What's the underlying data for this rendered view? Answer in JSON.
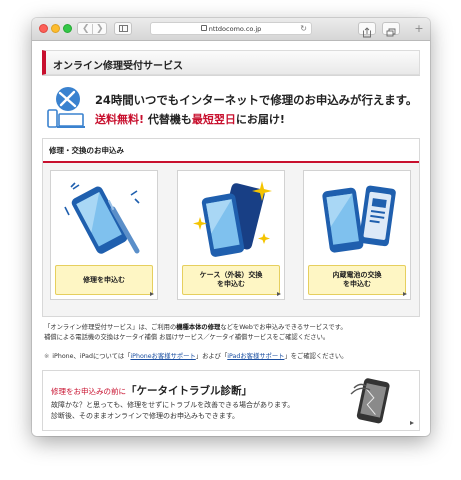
{
  "browser": {
    "url": "nttdocomo.co.jp",
    "icons": [
      "back-icon",
      "forward-icon",
      "sidebar-icon",
      "lock-icon",
      "reload-icon",
      "share-icon",
      "tabs-icon",
      "new-tab-icon"
    ]
  },
  "header": {
    "title": "オンライン修理受付サービス"
  },
  "promo": {
    "line1": "24時間いつでもインターネットで修理のお申込みが行えます。",
    "free": "送料無料",
    "excl": "!",
    "mid": " 代替機も",
    "fastest": "最短翌日",
    "tail": "にお届け!"
  },
  "panel": {
    "heading": "修理・交換のお申込み",
    "cards": [
      {
        "label": "修理を申込む"
      },
      {
        "label": "ケース（外装）交換\nを申込む"
      },
      {
        "label": "内蔵電池の交換\nを申込む"
      }
    ]
  },
  "notes": {
    "n1a": "「オンライン修理受付サービス」は、ご利用の",
    "n1b": "機種本体の修理",
    "n1c": "などをWebでお申込みできるサービスです。",
    "n1d": "補償による電話機の交換はケータイ補償 お届けサービス／ケータイ補償サービスをご確認ください。",
    "mark": "※",
    "n2a": "iPhone、iPadについては「",
    "link1": "iPhoneお客様サポート",
    "n2b": "」および「",
    "link2": "iPadお客様サポート",
    "n2c": "」をご確認ください。"
  },
  "trouble": {
    "pre": "修理をお申込みの前に",
    "main": "「ケータイトラブル診断」",
    "desc1": "故障かな？と思っても、修理をせずにトラブルを改善できる場合があります。",
    "desc2": "診断後、そのままオンラインで修理のお申込みもできます。"
  },
  "colors": {
    "accent": "#c8102e",
    "button_fill": "#fef6c4",
    "link": "#1a4ea0",
    "phone_blue": "#1f5fae"
  }
}
